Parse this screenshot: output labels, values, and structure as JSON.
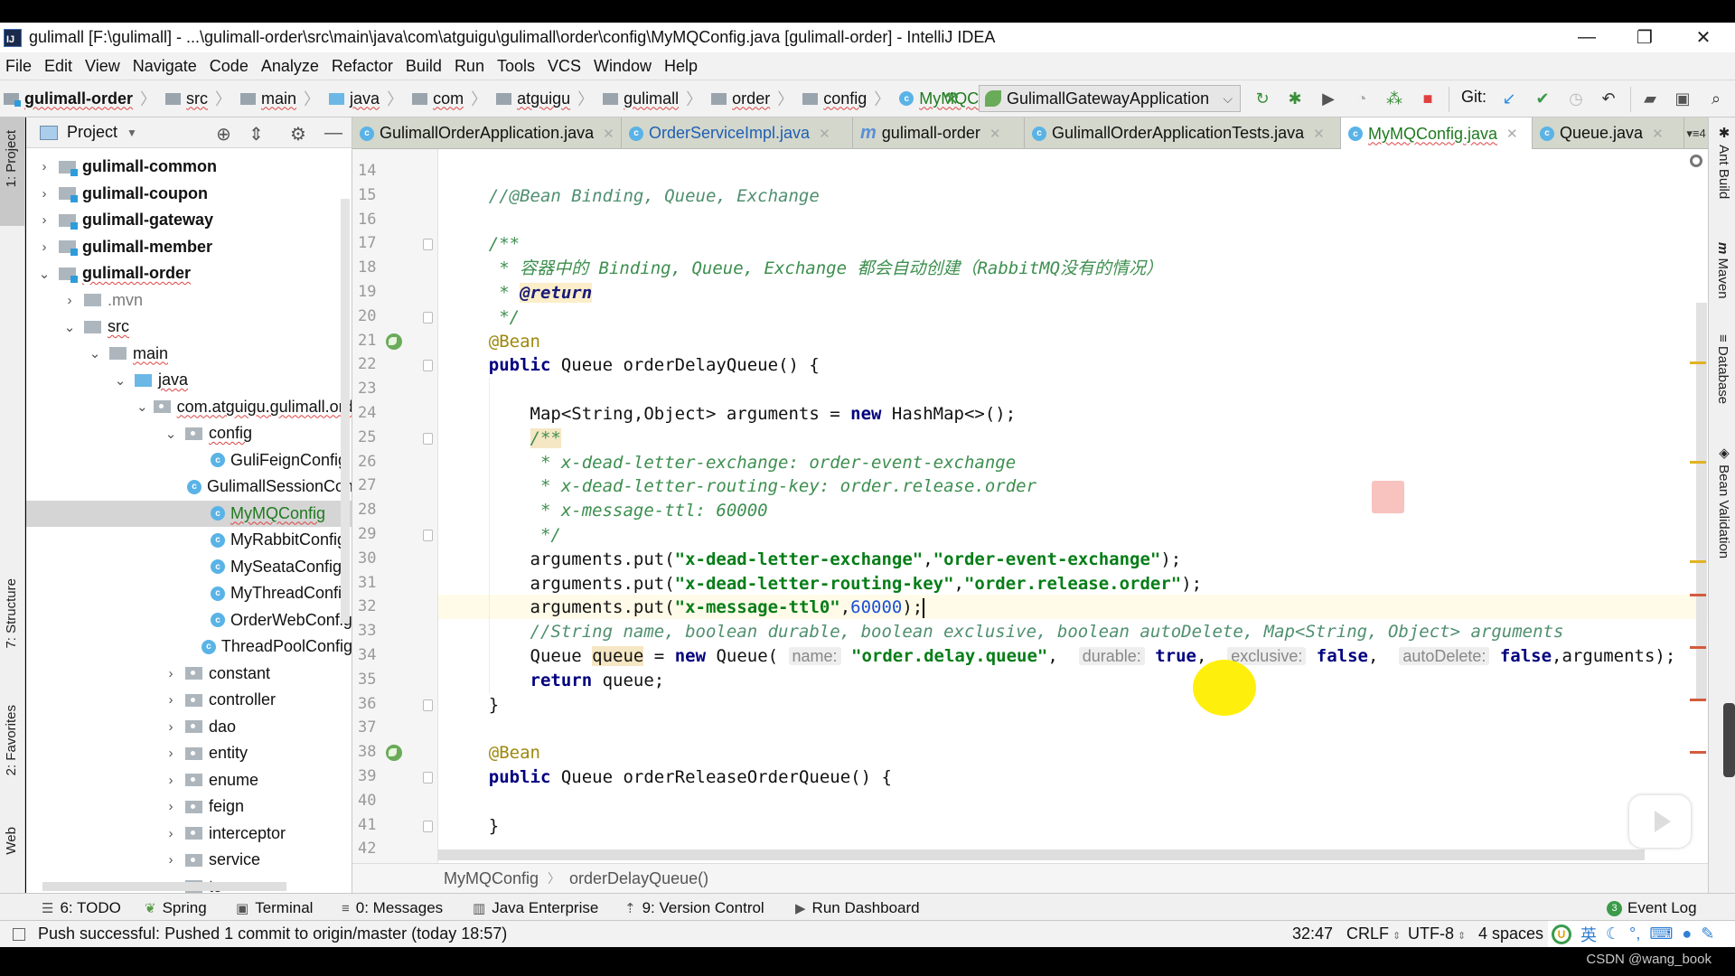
{
  "window": {
    "title": "gulimall [F:\\gulimall] - ...\\gulimall-order\\src\\main\\java\\com\\atguigu\\gulimall\\order\\config\\MyMQConfig.java [gulimall-order] - IntelliJ IDEA",
    "logo": "IJ",
    "minimize": "—",
    "restore": "❐",
    "close": "✕"
  },
  "menu": [
    "File",
    "Edit",
    "View",
    "Navigate",
    "Code",
    "Analyze",
    "Refactor",
    "Build",
    "Run",
    "Tools",
    "VCS",
    "Window",
    "Help"
  ],
  "nav_breadcrumb": [
    {
      "label": "gulimall-order",
      "icon": "module-folder-icon"
    },
    {
      "label": "src",
      "icon": "folder-icon"
    },
    {
      "label": "main",
      "icon": "folder-icon"
    },
    {
      "label": "java",
      "icon": "source-folder-icon"
    },
    {
      "label": "com",
      "icon": "package-icon"
    },
    {
      "label": "atguigu",
      "icon": "package-icon"
    },
    {
      "label": "gulimall",
      "icon": "package-icon"
    },
    {
      "label": "order",
      "icon": "package-icon"
    },
    {
      "label": "config",
      "icon": "package-icon"
    },
    {
      "label": "MyMQConfig",
      "icon": "class-icon"
    }
  ],
  "toolbar": {
    "run_config": "GulimallGatewayApplication",
    "git_label": "Git:"
  },
  "left_tool_tabs": {
    "project": "1: Project",
    "structure": "7: Structure",
    "favorites": "2: Favorites",
    "web": "Web"
  },
  "right_tool_tabs": {
    "ant": "Ant Build",
    "maven": "Maven",
    "database": "Database",
    "bean_validation": "Bean Validation"
  },
  "project_panel": {
    "title": "Project",
    "tree": [
      {
        "label": "gulimall-common",
        "depth": 0,
        "state": "collapsed",
        "type": "module"
      },
      {
        "label": "gulimall-coupon",
        "depth": 0,
        "state": "collapsed",
        "type": "module"
      },
      {
        "label": "gulimall-gateway",
        "depth": 0,
        "state": "collapsed",
        "type": "module"
      },
      {
        "label": "gulimall-member",
        "depth": 0,
        "state": "collapsed",
        "type": "module"
      },
      {
        "label": "gulimall-order",
        "depth": 0,
        "state": "expanded",
        "type": "module"
      },
      {
        "label": ".mvn",
        "depth": 1,
        "state": "collapsed",
        "type": "folder"
      },
      {
        "label": "src",
        "depth": 1,
        "state": "expanded",
        "type": "folder"
      },
      {
        "label": "main",
        "depth": 2,
        "state": "expanded",
        "type": "folder"
      },
      {
        "label": "java",
        "depth": 3,
        "state": "expanded",
        "type": "source"
      },
      {
        "label": "com.atguigu.gulimall.order",
        "depth": 4,
        "state": "expanded",
        "type": "package"
      },
      {
        "label": "config",
        "depth": 5,
        "state": "expanded",
        "type": "package"
      },
      {
        "label": "GuliFeignConfig",
        "depth": 6,
        "state": "leaf",
        "type": "class"
      },
      {
        "label": "GulimallSessionConfig",
        "depth": 6,
        "state": "leaf",
        "type": "class"
      },
      {
        "label": "MyMQConfig",
        "depth": 6,
        "state": "leaf",
        "type": "class",
        "selected": true
      },
      {
        "label": "MyRabbitConfig",
        "depth": 6,
        "state": "leaf",
        "type": "class"
      },
      {
        "label": "MySeataConfig",
        "depth": 6,
        "state": "leaf",
        "type": "class"
      },
      {
        "label": "MyThreadConfig",
        "depth": 6,
        "state": "leaf",
        "type": "class"
      },
      {
        "label": "OrderWebConfig",
        "depth": 6,
        "state": "leaf",
        "type": "class"
      },
      {
        "label": "ThreadPoolConfig",
        "depth": 6,
        "state": "leaf",
        "type": "class"
      },
      {
        "label": "constant",
        "depth": 5,
        "state": "collapsed",
        "type": "package"
      },
      {
        "label": "controller",
        "depth": 5,
        "state": "collapsed",
        "type": "package"
      },
      {
        "label": "dao",
        "depth": 5,
        "state": "collapsed",
        "type": "package"
      },
      {
        "label": "entity",
        "depth": 5,
        "state": "collapsed",
        "type": "package"
      },
      {
        "label": "enume",
        "depth": 5,
        "state": "collapsed",
        "type": "package"
      },
      {
        "label": "feign",
        "depth": 5,
        "state": "collapsed",
        "type": "package"
      },
      {
        "label": "interceptor",
        "depth": 5,
        "state": "collapsed",
        "type": "package"
      },
      {
        "label": "service",
        "depth": 5,
        "state": "collapsed",
        "type": "package"
      },
      {
        "label": "to",
        "depth": 5,
        "state": "collapsed",
        "type": "package"
      }
    ]
  },
  "tabs": [
    {
      "label": "GulimallOrderApplication.java",
      "icon": "spring-class-icon"
    },
    {
      "label": "OrderServiceImpl.java",
      "icon": "class-icon"
    },
    {
      "label": "gulimall-order",
      "icon": "maven-icon"
    },
    {
      "label": "GulimallOrderApplicationTests.java",
      "icon": "spring-class-icon"
    },
    {
      "label": "MyMQConfig.java",
      "icon": "class-icon",
      "active": true
    },
    {
      "label": "Queue.java",
      "icon": "class-icon"
    }
  ],
  "tabs_overflow": "▾≡4",
  "editor": {
    "first_line": 14,
    "lines": [
      {
        "n": 14,
        "tokens": []
      },
      {
        "n": 15,
        "tokens": [
          {
            "t": "    "
          },
          {
            "t": "//@Bean Binding, Queue, Exchange",
            "c": "cm"
          }
        ]
      },
      {
        "n": 16,
        "tokens": []
      },
      {
        "n": 17,
        "tokens": [
          {
            "t": "    "
          },
          {
            "t": "/**",
            "c": "doc"
          }
        ]
      },
      {
        "n": 18,
        "tokens": [
          {
            "t": "     "
          },
          {
            "t": "* 容器中的 Binding, Queue, Exchange 都会自动创建（RabbitMQ没有的情况）",
            "c": "doc"
          }
        ]
      },
      {
        "n": 19,
        "tokens": [
          {
            "t": "     "
          },
          {
            "t": "* ",
            "c": "doc"
          },
          {
            "t": "@return",
            "c": "doctag"
          }
        ]
      },
      {
        "n": 20,
        "tokens": [
          {
            "t": "     "
          },
          {
            "t": "*/",
            "c": "doc"
          }
        ]
      },
      {
        "n": 21,
        "tokens": [
          {
            "t": "    "
          },
          {
            "t": "@Bean",
            "c": "ann"
          }
        ]
      },
      {
        "n": 22,
        "tokens": [
          {
            "t": "    "
          },
          {
            "t": "public",
            "c": "kw"
          },
          {
            "t": " Queue orderDelayQueue() {"
          }
        ]
      },
      {
        "n": 23,
        "tokens": []
      },
      {
        "n": 24,
        "tokens": [
          {
            "t": "        Map<String,Object> arguments = "
          },
          {
            "t": "new",
            "c": "kw"
          },
          {
            "t": " HashMap<>();"
          }
        ]
      },
      {
        "n": 25,
        "tokens": [
          {
            "t": "        "
          },
          {
            "t": "/**",
            "c": "doc hl-ref"
          }
        ]
      },
      {
        "n": 26,
        "tokens": [
          {
            "t": "         "
          },
          {
            "t": "* x-dead-letter-exchange: order-event-exchange",
            "c": "doc"
          }
        ]
      },
      {
        "n": 27,
        "tokens": [
          {
            "t": "         "
          },
          {
            "t": "* x-dead-letter-routing-key: order.release.order",
            "c": "doc"
          }
        ]
      },
      {
        "n": 28,
        "tokens": [
          {
            "t": "         "
          },
          {
            "t": "* x-message-ttl: 60000",
            "c": "doc"
          }
        ]
      },
      {
        "n": 29,
        "tokens": [
          {
            "t": "         "
          },
          {
            "t": "*/",
            "c": "doc"
          }
        ]
      },
      {
        "n": 30,
        "tokens": [
          {
            "t": "        arguments.put("
          },
          {
            "t": "\"x-dead-letter-exchange\"",
            "c": "str"
          },
          {
            "t": ","
          },
          {
            "t": "\"order-event-exchange\"",
            "c": "str"
          },
          {
            "t": ");"
          }
        ]
      },
      {
        "n": 31,
        "tokens": [
          {
            "t": "        arguments.put("
          },
          {
            "t": "\"x-dead-letter-routing-key\"",
            "c": "str"
          },
          {
            "t": ","
          },
          {
            "t": "\"order.release.order\"",
            "c": "str"
          },
          {
            "t": ");"
          }
        ]
      },
      {
        "n": 32,
        "tokens": [
          {
            "t": "        arguments.put("
          },
          {
            "t": "\"x-message-ttl0\"",
            "c": "str"
          },
          {
            "t": ","
          },
          {
            "t": "60000",
            "c": "num"
          },
          {
            "t": ");"
          },
          {
            "t": "",
            "c": "caret"
          }
        ],
        "current": true
      },
      {
        "n": 33,
        "tokens": [
          {
            "t": "        "
          },
          {
            "t": "//String name, boolean durable, boolean exclusive, boolean autoDelete, Map<String, Object> arguments",
            "c": "cm"
          }
        ]
      },
      {
        "n": 34,
        "tokens": [
          {
            "t": "        Queue "
          },
          {
            "t": "queue",
            "c": "hl-ref"
          },
          {
            "t": " = "
          },
          {
            "t": "new",
            "c": "kw"
          },
          {
            "t": " Queue( "
          },
          {
            "t": "name:",
            "c": "hint"
          },
          {
            "t": " "
          },
          {
            "t": "\"order.delay.queue\"",
            "c": "str"
          },
          {
            "t": ",  "
          },
          {
            "t": "durable:",
            "c": "hint"
          },
          {
            "t": " "
          },
          {
            "t": "true",
            "c": "kw"
          },
          {
            "t": ",  "
          },
          {
            "t": "exclusive:",
            "c": "hint"
          },
          {
            "t": " "
          },
          {
            "t": "false",
            "c": "kw"
          },
          {
            "t": ",  "
          },
          {
            "t": "autoDelete:",
            "c": "hint"
          },
          {
            "t": " "
          },
          {
            "t": "false",
            "c": "kw"
          },
          {
            "t": ",arguments);"
          }
        ]
      },
      {
        "n": 35,
        "tokens": [
          {
            "t": "        "
          },
          {
            "t": "return",
            "c": "kw"
          },
          {
            "t": " queue;"
          }
        ]
      },
      {
        "n": 36,
        "tokens": [
          {
            "t": "    }"
          }
        ]
      },
      {
        "n": 37,
        "tokens": []
      },
      {
        "n": 38,
        "tokens": [
          {
            "t": "    "
          },
          {
            "t": "@Bean",
            "c": "ann"
          }
        ]
      },
      {
        "n": 39,
        "tokens": [
          {
            "t": "    "
          },
          {
            "t": "public",
            "c": "kw"
          },
          {
            "t": " Queue orderReleaseOrderQueue() {"
          }
        ]
      },
      {
        "n": 40,
        "tokens": []
      },
      {
        "n": 41,
        "tokens": [
          {
            "t": "    }"
          }
        ]
      },
      {
        "n": 42,
        "tokens": []
      }
    ]
  },
  "editor_breadcrumb": [
    "MyMQConfig",
    "orderDelayQueue()"
  ],
  "tool_windows": [
    {
      "label": "6: TODO",
      "icon": "todo-icon"
    },
    {
      "label": "Spring",
      "icon": "spring-icon"
    },
    {
      "label": "Terminal",
      "icon": "terminal-icon"
    },
    {
      "label": "0: Messages",
      "icon": "messages-icon"
    },
    {
      "label": "Java Enterprise",
      "icon": "java-enterprise-icon"
    },
    {
      "label": "9: Version Control",
      "icon": "version-control-icon"
    },
    {
      "label": "Run Dashboard",
      "icon": "run-dashboard-icon"
    }
  ],
  "event_log": {
    "label": "Event Log",
    "count": "3"
  },
  "status": {
    "message": "Push successful: Pushed 1 commit to origin/master (today 18:57)",
    "position": "32:47",
    "line_sep": "CRLF",
    "encoding": "UTF-8",
    "indent": "4 spaces",
    "ime_lang": "英"
  },
  "watermark": "CSDN @wang_book"
}
